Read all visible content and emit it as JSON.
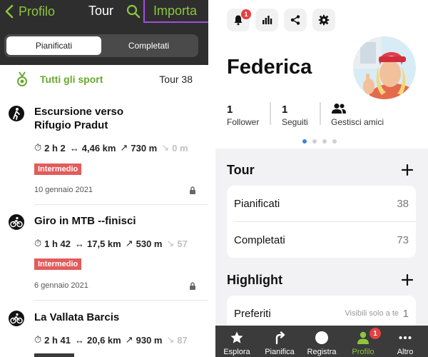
{
  "left": {
    "header": {
      "back_label": "Profilo",
      "title": "Tour",
      "import_label": "Importa"
    },
    "segments": [
      {
        "label": "Pianificati",
        "active": true
      },
      {
        "label": "Completati",
        "active": false
      }
    ],
    "sport_filter": {
      "label": "Tutti gli sport",
      "count_label": "Tour 38"
    },
    "tours": [
      {
        "title_line1": "Escursione verso",
        "title_line2": "Rifugio Pradut",
        "sport_icon": "hiking-icon",
        "duration": "2 h 2",
        "distance": "4,46 km",
        "ascent": "730 m",
        "descent": "0 m",
        "difficulty": "Intermedio",
        "date": "10 gennaio 2021",
        "private": true
      },
      {
        "title_line1": "Giro in MTB --finisci",
        "title_line2": "",
        "sport_icon": "mountain-bike-icon",
        "duration": "1 h 42",
        "distance": "17,5 km",
        "ascent": "530 m",
        "descent": "57",
        "difficulty": "Intermedio",
        "date": "6 gennaio 2021",
        "private": true
      },
      {
        "title_line1": "La Vallata Barcis",
        "title_line2": "",
        "sport_icon": "mountain-bike-icon",
        "duration": "2 h 41",
        "distance": "20,6 km",
        "ascent": "930 m",
        "descent": "87",
        "difficulty": "",
        "date": "",
        "private": false
      }
    ]
  },
  "right": {
    "top_icons": [
      {
        "name": "notifications-icon",
        "badge": "1"
      },
      {
        "name": "statistics-icon"
      },
      {
        "name": "share-icon"
      },
      {
        "name": "settings-icon"
      }
    ],
    "profile": {
      "name": "Federica"
    },
    "stats": {
      "followers_count": "1",
      "followers_label": "Follower",
      "following_count": "1",
      "following_label": "Seguiti",
      "manage_friends_label": "Gestisci amici"
    },
    "tour_section": {
      "title": "Tour",
      "rows": [
        {
          "label": "Pianificati",
          "value": "38"
        },
        {
          "label": "Completati",
          "value": "73"
        }
      ]
    },
    "highlight_section": {
      "title": "Highlight",
      "rows": [
        {
          "label": "Preferiti",
          "hint": "Visibili solo a te",
          "value": "1"
        }
      ]
    },
    "tabbar": [
      {
        "label": "Esplora",
        "icon": "star-icon",
        "active": false
      },
      {
        "label": "Pianifica",
        "icon": "route-arrow-icon",
        "active": false
      },
      {
        "label": "Registra",
        "icon": "record-icon",
        "active": false
      },
      {
        "label": "Profilo",
        "icon": "person-icon",
        "active": true,
        "badge": "1"
      },
      {
        "label": "Altro",
        "icon": "more-icon",
        "active": false
      }
    ]
  },
  "colors": {
    "accent_green": "#8cc63f",
    "badge_red": "#e35b5b",
    "header_dark": "#2e2e2e",
    "tabbar_dark": "#3b3b3b",
    "highlight_purple": "#a64ce0",
    "page_dot_blue": "#3d84d6"
  }
}
